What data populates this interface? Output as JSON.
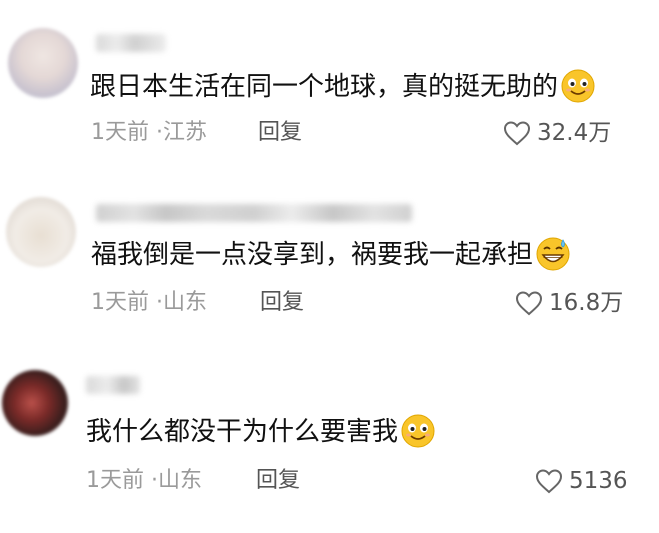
{
  "comments": [
    {
      "text": "跟日本生活在同一个地球，真的挺无助的",
      "time": "1天前",
      "location": "江苏",
      "reply_label": "回复",
      "likes": "32.4万",
      "emoji": "smile-emoji"
    },
    {
      "text": "福我倒是一点没享到，祸要我一起承担",
      "time": "1天前",
      "location": "山东",
      "reply_label": "回复",
      "likes": "16.8万",
      "emoji": "grin-sweat-emoji"
    },
    {
      "text": "我什么都没干为什么要害我",
      "time": "1天前",
      "location": "山东",
      "reply_label": "回复",
      "likes": "5136",
      "emoji": "smile-emoji"
    }
  ],
  "meta_separator": "·",
  "icons": {
    "like": "heart-outline-icon"
  },
  "colors": {
    "text": "#111111",
    "meta": "#9a9a9a",
    "secondary": "#555555",
    "emoji_face": "#f9c52a"
  }
}
